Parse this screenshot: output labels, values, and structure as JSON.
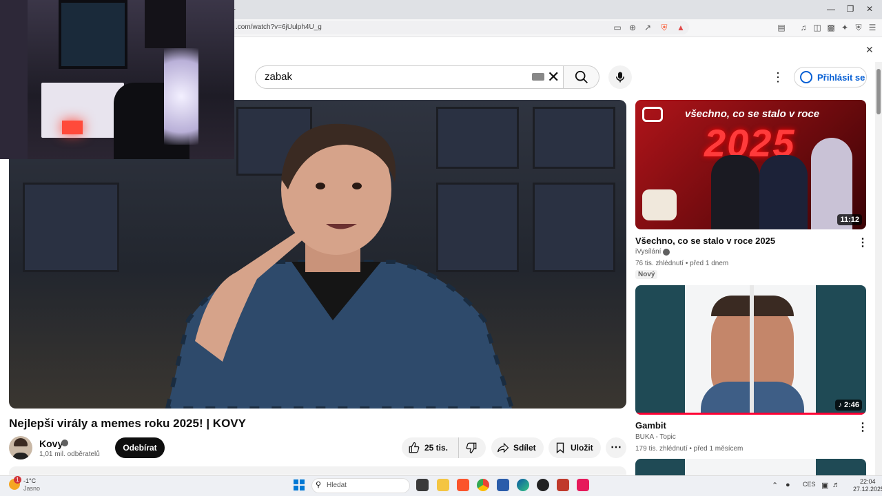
{
  "browser": {
    "url": ".com/watch?v=6jUulph4U_g",
    "tab_new_symbol": "+"
  },
  "header": {
    "search_value": "zabak",
    "signin_label": "Přihlásit se"
  },
  "video": {
    "title": "Nejlepší virály a memes roku 2025! | KOVY",
    "channel": "Kovy",
    "subscribers": "1,01 mil. odběratelů",
    "subscribe_label": "Odebírat",
    "likes": "25 tis.",
    "share_label": "Sdílet",
    "save_label": "Uložit"
  },
  "recommendations": [
    {
      "title": "Všechno, co se stalo v roce 2025",
      "channel": "iVysílání",
      "meta": "76 tis. zhlédnutí • před 1 dnem",
      "duration": "11:12",
      "badge": "Nový",
      "thumb_text": "všechno, co se stalo v roce",
      "thumb_year": "2025"
    },
    {
      "title": "Gambit",
      "channel": "BUKA - Topic",
      "meta": "179 tis. zhlédnutí • před 1 měsícem",
      "duration": "♪ 2:46"
    }
  ],
  "taskbar": {
    "weather_temp": "-1°C",
    "weather_desc": "Jasno",
    "weather_badge": "1",
    "search_placeholder": "Hledat",
    "language": "CES",
    "time": "22:04",
    "date": "27.12.2025"
  },
  "colors": {
    "accent_blue": "#065fd4",
    "youtube_text": "#0f0f0f",
    "muted_text": "#606060"
  }
}
